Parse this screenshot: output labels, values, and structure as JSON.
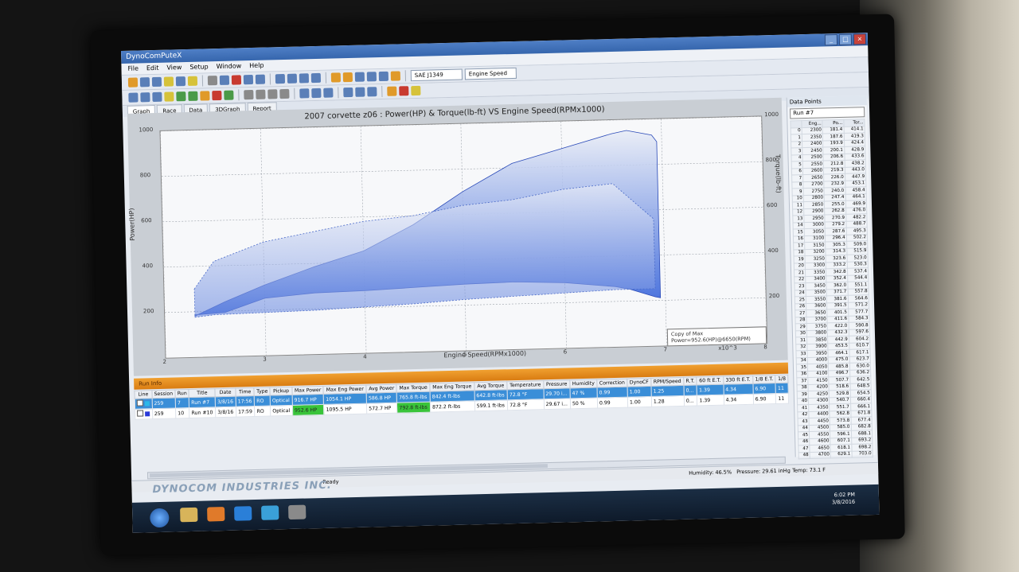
{
  "window": {
    "title": "DynoComPuteX"
  },
  "menu": [
    "File",
    "Edit",
    "View",
    "Setup",
    "Window",
    "Help"
  ],
  "toolbar": {
    "correction": "SAE J1349",
    "xaxis": "Engine Speed"
  },
  "tabs": [
    "Graph",
    "Race",
    "Data",
    "3DGraph",
    "Report"
  ],
  "chart_data": {
    "type": "area",
    "title": "2007 corvette z06 : Power(HP) & Torque(lb-ft) VS Engine Speed(RPMx1000)",
    "xlabel": "Engine Speed(RPMx1000)",
    "ylabel_left": "Power(HP)",
    "ylabel_right": "Torque(lb-ft)",
    "x_ticks": [
      "2",
      "3",
      "4",
      "5",
      "6",
      "7",
      "8"
    ],
    "x_multiplier": "x10^3",
    "y_ticks_left": [
      "200",
      "400",
      "600",
      "800",
      "1000"
    ],
    "y_ticks_right": [
      "200",
      "400",
      "600",
      "800",
      "1000"
    ],
    "xlim": [
      2,
      8
    ],
    "ylim": [
      0,
      1000
    ],
    "legend": [
      "Copy of Max Power=952.6(HP)@6650(RPM)"
    ],
    "legend_position": "bottom-right",
    "grid": true,
    "series": [
      {
        "name": "Run #7",
        "x": [
          2.3,
          2.6,
          3.0,
          3.5,
          4.0,
          4.5,
          5.0,
          5.5,
          6.0,
          6.5,
          6.65,
          6.9,
          6.95
        ],
        "power": [
          181,
          240,
          310,
          385,
          450,
          560,
          700,
          820,
          880,
          940,
          952.6,
          930,
          900
        ],
        "torque": [
          414,
          430,
          560,
          600,
          610,
          630,
          650,
          660,
          640,
          590,
          560,
          480,
          470
        ]
      },
      {
        "name": "Run #10",
        "x": [
          2.3,
          2.5,
          3.0,
          3.5,
          4.0,
          4.5,
          5.0,
          5.5,
          6.0,
          6.5,
          6.9
        ],
        "power": [
          300,
          420,
          500,
          540,
          580,
          600,
          640,
          660,
          700,
          720,
          560
        ],
        "torque": [
          390,
          410,
          420,
          430,
          450,
          470,
          500,
          520,
          540,
          560,
          560
        ]
      }
    ]
  },
  "data_points": {
    "header": "Data Points",
    "run": "Run #7",
    "columns": [
      "",
      "Eng...",
      "Po...",
      "Tor..."
    ],
    "rows": [
      [
        "0",
        "2300",
        "181.4",
        "414.1"
      ],
      [
        "1",
        "2350",
        "187.6",
        "419.3"
      ],
      [
        "2",
        "2400",
        "193.9",
        "424.4"
      ],
      [
        "3",
        "2450",
        "200.1",
        "428.9"
      ],
      [
        "4",
        "2500",
        "206.6",
        "433.6"
      ],
      [
        "5",
        "2550",
        "212.8",
        "438.2"
      ],
      [
        "6",
        "2600",
        "219.3",
        "443.0"
      ],
      [
        "7",
        "2650",
        "226.0",
        "447.9"
      ],
      [
        "8",
        "2700",
        "232.9",
        "453.1"
      ],
      [
        "9",
        "2750",
        "240.0",
        "458.4"
      ],
      [
        "10",
        "2800",
        "247.4",
        "464.1"
      ],
      [
        "11",
        "2850",
        "255.0",
        "469.9"
      ],
      [
        "12",
        "2900",
        "262.8",
        "476.0"
      ],
      [
        "13",
        "2950",
        "270.9",
        "482.2"
      ],
      [
        "14",
        "3000",
        "279.2",
        "488.7"
      ],
      [
        "15",
        "3050",
        "287.6",
        "495.3"
      ],
      [
        "16",
        "3100",
        "296.4",
        "502.2"
      ],
      [
        "17",
        "3150",
        "305.3",
        "509.0"
      ],
      [
        "18",
        "3200",
        "314.3",
        "515.9"
      ],
      [
        "19",
        "3250",
        "323.6",
        "523.0"
      ],
      [
        "20",
        "3300",
        "333.2",
        "530.3"
      ],
      [
        "21",
        "3350",
        "342.8",
        "537.4"
      ],
      [
        "22",
        "3400",
        "352.4",
        "544.4"
      ],
      [
        "23",
        "3450",
        "362.0",
        "551.1"
      ],
      [
        "24",
        "3500",
        "371.7",
        "557.8"
      ],
      [
        "25",
        "3550",
        "381.6",
        "564.6"
      ],
      [
        "26",
        "3600",
        "391.5",
        "571.2"
      ],
      [
        "27",
        "3650",
        "401.5",
        "577.7"
      ],
      [
        "28",
        "3700",
        "411.6",
        "584.3"
      ],
      [
        "29",
        "3750",
        "422.0",
        "590.8"
      ],
      [
        "30",
        "3800",
        "432.3",
        "597.6"
      ],
      [
        "31",
        "3850",
        "442.9",
        "604.2"
      ],
      [
        "32",
        "3900",
        "453.5",
        "610.7"
      ],
      [
        "33",
        "3950",
        "464.1",
        "617.1"
      ],
      [
        "34",
        "4000",
        "475.0",
        "623.7"
      ],
      [
        "35",
        "4050",
        "485.8",
        "630.0"
      ],
      [
        "36",
        "4100",
        "496.7",
        "636.2"
      ],
      [
        "37",
        "4150",
        "507.7",
        "642.5"
      ],
      [
        "38",
        "4200",
        "518.6",
        "648.5"
      ],
      [
        "39",
        "4250",
        "529.8",
        "654.5"
      ],
      [
        "40",
        "4300",
        "540.7",
        "660.4"
      ],
      [
        "41",
        "4350",
        "551.7",
        "666.1"
      ],
      [
        "42",
        "4400",
        "562.8",
        "671.8"
      ],
      [
        "43",
        "4450",
        "573.8",
        "677.4"
      ],
      [
        "44",
        "4500",
        "585.0",
        "682.8"
      ],
      [
        "45",
        "4550",
        "596.1",
        "688.1"
      ],
      [
        "46",
        "4600",
        "607.1",
        "693.2"
      ],
      [
        "47",
        "4650",
        "618.1",
        "698.2"
      ],
      [
        "48",
        "4700",
        "629.1",
        "703.0"
      ]
    ]
  },
  "run_info": {
    "title": "Run Info",
    "columns": [
      "Line",
      "Session",
      "Run",
      "Title",
      "Date",
      "Time",
      "Type",
      "Pickup",
      "Max Power",
      "Max Eng Power",
      "Avg Power",
      "Max Torque",
      "Max Eng Torque",
      "Avg Torque",
      "Temperature",
      "Pressure",
      "Humidity",
      "Correction",
      "DynoCF",
      "RPM/Speed",
      "R.T.",
      "60 ft E.T.",
      "330 ft E.T.",
      "1/8 E.T.",
      "1/8"
    ],
    "rows": [
      [
        "",
        "259",
        "7",
        "Run #7",
        "3/8/16",
        "17:56",
        "RO",
        "Optical",
        "916.7 HP",
        "1054.1 HP",
        "586.8 HP",
        "765.8 ft-lbs",
        "842.4 ft-lbs",
        "642.8 ft-lbs",
        "72.8 °F",
        "29.70 i...",
        "47 %",
        "0.99",
        "1.00",
        "1.25",
        "0...",
        "1.39",
        "4.34",
        "6.90",
        "11"
      ],
      [
        "",
        "259",
        "10",
        "Run #10",
        "3/8/16",
        "17:59",
        "RO",
        "Optical",
        "952.6 HP",
        "1095.5 HP",
        "572.7 HP",
        "792.8 ft-lbs",
        "872.2 ft-lbs",
        "599.1 ft-lbs",
        "72.8 °F",
        "29.67 i...",
        "50 %",
        "0.99",
        "1.00",
        "1.28",
        "0...",
        "1.39",
        "4.34",
        "6.90",
        "11"
      ]
    ]
  },
  "status": {
    "ready": "Ready",
    "humidity": "Humidity: 46.5%",
    "pressure": "Pressure: 29.61 inHg",
    "temp": "Temp: 73.1 F"
  },
  "brand": "DYNOCOM INDUSTRIES INC.",
  "clock": {
    "time": "6:02 PM",
    "date": "3/8/2016"
  },
  "colors": {
    "accent": "#3a78d8",
    "runinfo": "#e28a1a",
    "highlight": "#39c43a"
  }
}
